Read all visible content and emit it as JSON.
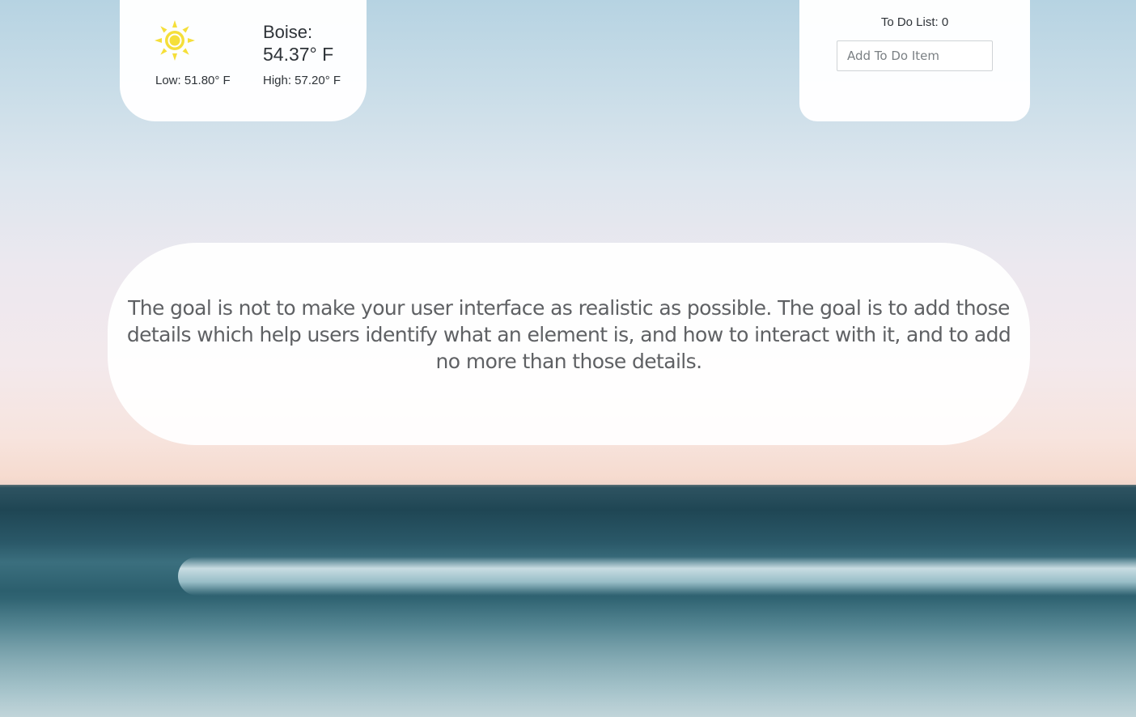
{
  "weather": {
    "icon": "sun-icon",
    "icon_color": "#f5df3a",
    "city": "Boise:",
    "temperature": "54.37° F",
    "low": "Low: 51.80° F",
    "high": "High: 57.20° F"
  },
  "todo": {
    "title": "To Do List: 0",
    "input_placeholder": "Add To Do Item"
  },
  "quote": {
    "text": "The goal is not to make your user interface as realistic as possible. The goal is to add those details which help users identify what an element is, and how to interact with it, and to add no more than those details."
  }
}
